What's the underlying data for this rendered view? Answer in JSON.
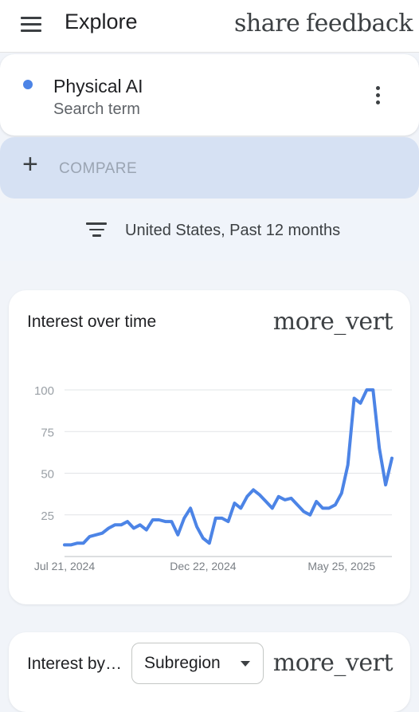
{
  "header": {
    "title": "Explore",
    "menu_icon": "menu-icon",
    "share_icon_text": "share",
    "feedback_icon_text": "feedback"
  },
  "search_term": {
    "name": "Physical AI",
    "type": "Search term",
    "color": "#4c84e6"
  },
  "compare": {
    "plus": "+",
    "label": "COMPARE"
  },
  "filter": {
    "icon": "filter-list-icon",
    "text": "United States, Past 12 months"
  },
  "interest_over_time": {
    "title": "Interest over time",
    "menu_icon_text": "more_vert"
  },
  "chart_data": {
    "type": "line",
    "title": "",
    "xlabel": "",
    "ylabel": "",
    "ylim": [
      0,
      100
    ],
    "yticks": [
      25,
      50,
      75,
      100
    ],
    "x_tick_labels": [
      "Jul 21, 2024",
      "Dec 22, 2024",
      "May 25, 2025"
    ],
    "x_tick_indices": [
      0,
      22,
      44
    ],
    "grid": true,
    "line_color": "#4c84e6",
    "series": [
      {
        "values": [
          7,
          7,
          8,
          8,
          12,
          13,
          14,
          17,
          19,
          19,
          21,
          17,
          19,
          16,
          22,
          22,
          21,
          21,
          13,
          23,
          29,
          18,
          11,
          8,
          23,
          23,
          21,
          32,
          29,
          36,
          40,
          37,
          33,
          29,
          36,
          34,
          35,
          31,
          27,
          25,
          33,
          29,
          29,
          31,
          38,
          55,
          95,
          92,
          100,
          100,
          65,
          43,
          59
        ]
      }
    ]
  },
  "interest_by_region": {
    "title": "Interest by…",
    "select_value": "Subregion",
    "menu_icon_text": "more_vert"
  }
}
